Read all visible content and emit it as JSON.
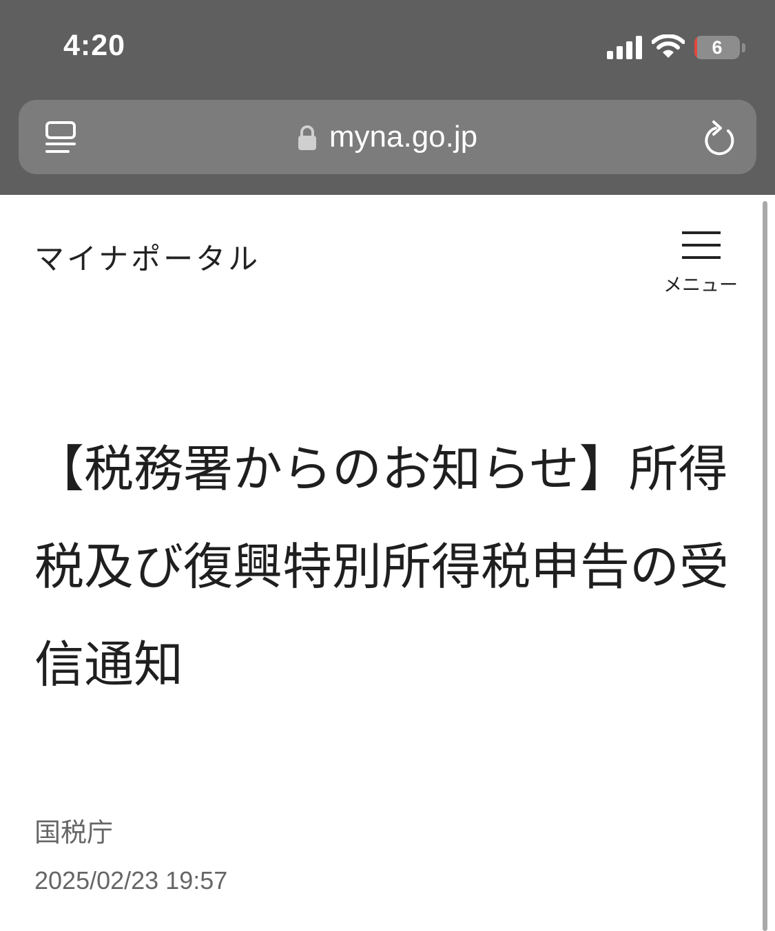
{
  "status_bar": {
    "time": "4:20",
    "battery_level": "6",
    "battery_fraction": 0.06,
    "icons": [
      "signal-icon",
      "wifi-icon",
      "battery-icon"
    ]
  },
  "browser": {
    "url": "myna.go.jp",
    "icons": [
      "reader-icon",
      "lock-icon",
      "reload-icon"
    ]
  },
  "header": {
    "site_title": "マイナポータル",
    "menu_label": "メニュー"
  },
  "article": {
    "title": "【税務署からのお知らせ】所得税及び復興特別所得税申告の受信通知",
    "source": "国税庁",
    "datetime": "2025/02/23 19:57"
  },
  "colors": {
    "chrome_bg": "#5f5f5f",
    "url_bar_bg": "#7c7c7c",
    "battery_red": "#e5463d",
    "text_dark": "#1f1f1f",
    "text_muted": "#666666"
  }
}
